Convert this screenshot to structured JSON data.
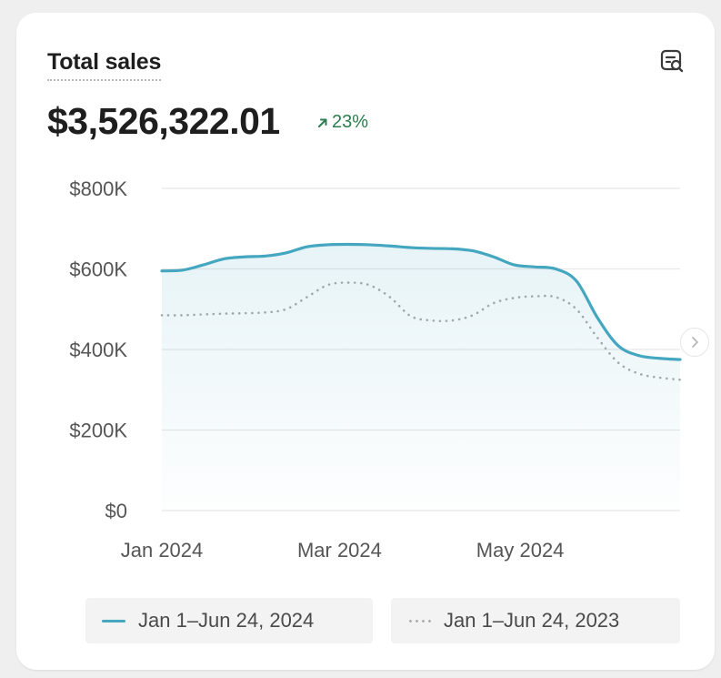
{
  "card": {
    "title": "Total sales",
    "total_value": "$3,526,322.01",
    "change": {
      "value": "23%",
      "direction": "up",
      "color": "#2a7d4f"
    },
    "action_icon": "report-search-icon"
  },
  "chart_data": {
    "type": "area",
    "ylim": [
      0,
      800000
    ],
    "y_ticks": [
      {
        "value": 800000,
        "label": "$800K"
      },
      {
        "value": 600000,
        "label": "$600K"
      },
      {
        "value": 400000,
        "label": "$400K"
      },
      {
        "value": 200000,
        "label": "$200K"
      },
      {
        "value": 0,
        "label": "$0"
      }
    ],
    "x_ticks": [
      {
        "value": "2024-01-01",
        "label": "Jan 2024"
      },
      {
        "value": "2024-03-01",
        "label": "Mar 2024"
      },
      {
        "value": "2024-05-01",
        "label": "May 2024"
      }
    ],
    "xlim": [
      "2024-01-01",
      "2024-06-24"
    ],
    "grid": true,
    "legend_position": "bottom",
    "series": [
      {
        "name": "Jan 1–Jun 24, 2024",
        "style": "solid",
        "color": "#45a6c0",
        "fill": true,
        "points": [
          [
            "2024-01-01",
            595000
          ],
          [
            "2024-01-08",
            597000
          ],
          [
            "2024-01-15",
            610000
          ],
          [
            "2024-01-22",
            625000
          ],
          [
            "2024-01-29",
            630000
          ],
          [
            "2024-02-05",
            632000
          ],
          [
            "2024-02-12",
            640000
          ],
          [
            "2024-02-19",
            655000
          ],
          [
            "2024-02-26",
            660000
          ],
          [
            "2024-03-04",
            661000
          ],
          [
            "2024-03-11",
            660000
          ],
          [
            "2024-03-18",
            657000
          ],
          [
            "2024-03-25",
            653000
          ],
          [
            "2024-04-01",
            651000
          ],
          [
            "2024-04-08",
            650000
          ],
          [
            "2024-04-15",
            645000
          ],
          [
            "2024-04-22",
            630000
          ],
          [
            "2024-04-29",
            610000
          ],
          [
            "2024-05-06",
            605000
          ],
          [
            "2024-05-13",
            600000
          ],
          [
            "2024-05-20",
            570000
          ],
          [
            "2024-05-27",
            480000
          ],
          [
            "2024-06-03",
            410000
          ],
          [
            "2024-06-10",
            385000
          ],
          [
            "2024-06-17",
            378000
          ],
          [
            "2024-06-24",
            375000
          ]
        ]
      },
      {
        "name": "Jan 1–Jun 24, 2023",
        "style": "dotted",
        "color": "#a9a9a9",
        "fill": false,
        "points": [
          [
            "2024-01-01",
            485000
          ],
          [
            "2024-01-08",
            485000
          ],
          [
            "2024-01-15",
            487000
          ],
          [
            "2024-01-22",
            489000
          ],
          [
            "2024-01-29",
            490000
          ],
          [
            "2024-02-05",
            492000
          ],
          [
            "2024-02-12",
            500000
          ],
          [
            "2024-02-19",
            530000
          ],
          [
            "2024-02-26",
            560000
          ],
          [
            "2024-03-04",
            566000
          ],
          [
            "2024-03-11",
            560000
          ],
          [
            "2024-03-18",
            530000
          ],
          [
            "2024-03-25",
            483000
          ],
          [
            "2024-04-01",
            472000
          ],
          [
            "2024-04-08",
            472000
          ],
          [
            "2024-04-15",
            485000
          ],
          [
            "2024-04-22",
            515000
          ],
          [
            "2024-04-29",
            528000
          ],
          [
            "2024-05-06",
            532000
          ],
          [
            "2024-05-13",
            530000
          ],
          [
            "2024-05-20",
            500000
          ],
          [
            "2024-05-27",
            430000
          ],
          [
            "2024-06-03",
            368000
          ],
          [
            "2024-06-10",
            340000
          ],
          [
            "2024-06-17",
            330000
          ],
          [
            "2024-06-24",
            325000
          ]
        ]
      }
    ]
  }
}
